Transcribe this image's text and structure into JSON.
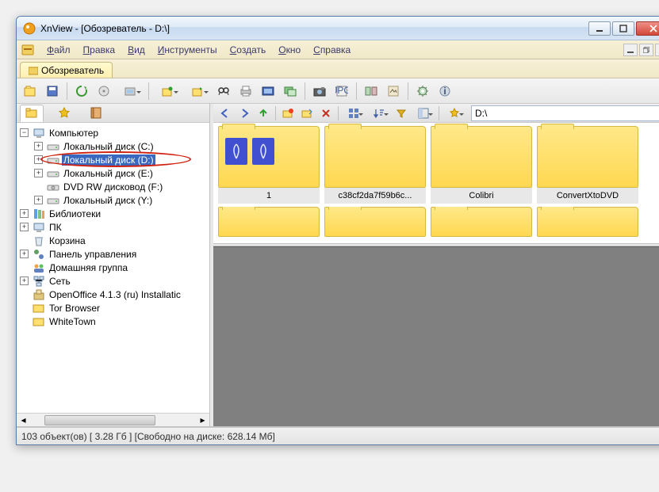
{
  "title": "XnView - [Обозреватель - D:\\]",
  "menu": {
    "items": [
      "Файл",
      "Правка",
      "Вид",
      "Инструменты",
      "Создать",
      "Окно",
      "Справка"
    ]
  },
  "tab": {
    "label": "Обозреватель"
  },
  "nav": {
    "path": "D:\\"
  },
  "tree": {
    "root": "Компьютер",
    "drives": [
      {
        "label": "Локальный диск (C:)",
        "selected": false,
        "expandable": true
      },
      {
        "label": "Локальный диск (D:)",
        "selected": true,
        "expandable": true
      },
      {
        "label": "Локальный диск (E:)",
        "selected": false,
        "expandable": true
      },
      {
        "label": "DVD RW дисковод (F:)",
        "selected": false,
        "expandable": false
      },
      {
        "label": "Локальный диск (Y:)",
        "selected": false,
        "expandable": true
      }
    ],
    "others": [
      "Библиотеки",
      "ПК",
      "Корзина",
      "Панель управления",
      "Домашняя группа",
      "Сеть",
      "OpenOffice 4.1.3 (ru) Installatic",
      "Tor Browser",
      "WhiteTown"
    ]
  },
  "folders": {
    "row1": [
      "1",
      "c38cf2da7f59b6c...",
      "Colibri",
      "ConvertXtoDVD"
    ]
  },
  "status": "103 объект(ов) [ 3.28 Гб ] [Свободно на диске: 628.14 Мб]"
}
